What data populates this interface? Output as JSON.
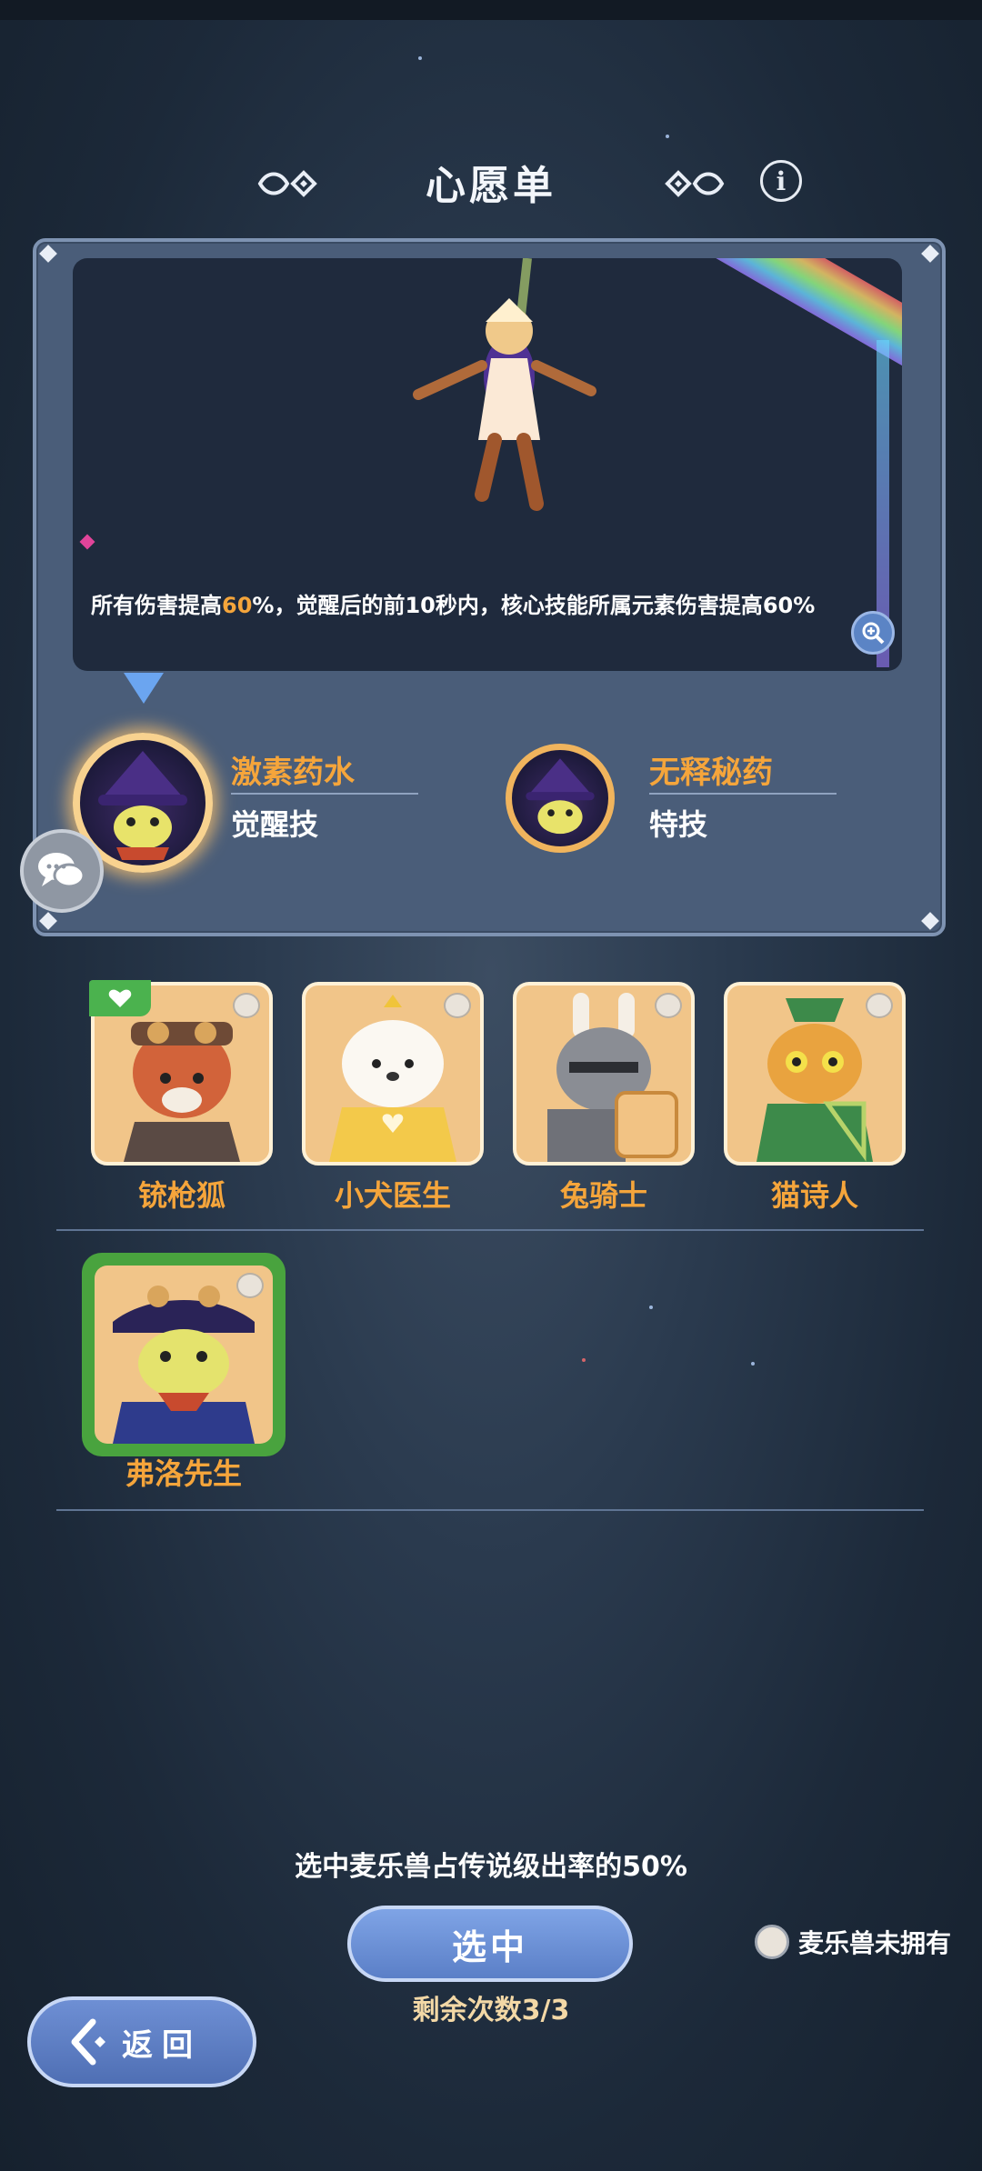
{
  "header": {
    "title": "心愿单"
  },
  "skill_preview": {
    "description_prefix": "所有伤害提高",
    "description_highlight": "60",
    "description_suffix": "%，觉醒后的前10秒内，核心技能所属元素伤害提高60%"
  },
  "skills": [
    {
      "name": "激素药水",
      "type": "觉醒技"
    },
    {
      "name": "无释秘药",
      "type": "特技"
    }
  ],
  "pets": [
    {
      "name": "铳枪狐"
    },
    {
      "name": "小犬医生"
    },
    {
      "name": "兔骑士"
    },
    {
      "name": "猫诗人"
    },
    {
      "name": "弗洛先生"
    }
  ],
  "bottom": {
    "rate_text": "选中麦乐兽占传说级出率的50%",
    "select_label": "选中",
    "remaining": "剩余次数3/3",
    "not_owned_label": "麦乐兽未拥有",
    "back_label": "返回"
  },
  "colors": {
    "accent": "#f5a53b",
    "selected": "#49a33e",
    "panel": "#4a5d79"
  },
  "icons": [
    "info-icon",
    "zoom-icon",
    "chat-icon",
    "heart-icon",
    "own-badge-icon",
    "back-arrow-icon"
  ]
}
